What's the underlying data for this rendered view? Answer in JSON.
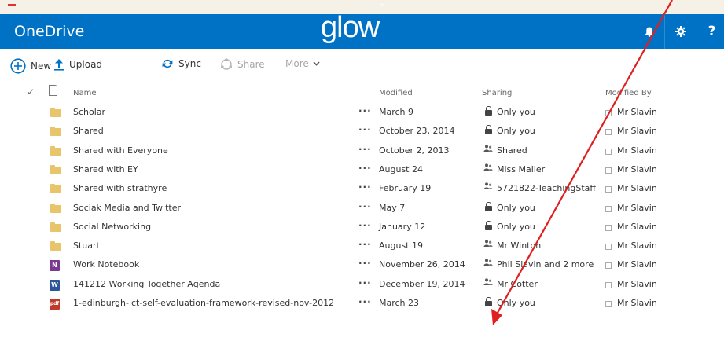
{
  "header": {
    "app_name": "OneDrive",
    "logo_text": "glow",
    "logo_mark": "™",
    "bell_icon": "bell-icon",
    "gear_icon": "gear-icon",
    "help_label": "?"
  },
  "toolbar": {
    "new_label": "New",
    "upload_label": "Upload",
    "sync_label": "Sync",
    "share_label": "Share",
    "more_label": "More"
  },
  "columns": {
    "name": "Name",
    "modified": "Modified",
    "sharing": "Sharing",
    "modified_by": "Modified By"
  },
  "files": [
    {
      "type": "folder",
      "name": "Scholar",
      "modified": "March 9",
      "sharing": "Only you",
      "sharing_icon": "lock-icon",
      "modified_by": "Mr Slavin"
    },
    {
      "type": "folder",
      "name": "Shared",
      "modified": "October 23, 2014",
      "sharing": "Only you",
      "sharing_icon": "lock-icon",
      "modified_by": "Mr Slavin"
    },
    {
      "type": "folder",
      "name": "Shared with Everyone",
      "modified": "October 2, 2013",
      "sharing": "Shared",
      "sharing_icon": "people-icon",
      "modified_by": "Mr Slavin"
    },
    {
      "type": "folder",
      "name": "Shared with EY",
      "modified": "August 24",
      "sharing": "Miss Mailer",
      "sharing_icon": "people-icon",
      "modified_by": "Mr Slavin"
    },
    {
      "type": "folder",
      "name": "Shared with strathyre",
      "modified": "February 19",
      "sharing": "5721822-TeachingStaff",
      "sharing_icon": "people-icon",
      "modified_by": "Mr Slavin"
    },
    {
      "type": "folder",
      "name": "Sociak Media and Twitter",
      "modified": "May 7",
      "sharing": "Only you",
      "sharing_icon": "lock-icon",
      "modified_by": "Mr Slavin"
    },
    {
      "type": "folder",
      "name": "Social Networking",
      "modified": "January 12",
      "sharing": "Only you",
      "sharing_icon": "lock-icon",
      "modified_by": "Mr Slavin"
    },
    {
      "type": "folder",
      "name": "Stuart",
      "modified": "August 19",
      "sharing": "Mr Winton",
      "sharing_icon": "people-icon",
      "modified_by": "Mr Slavin"
    },
    {
      "type": "onenote",
      "name": "Work Notebook",
      "modified": "November 26, 2014",
      "sharing": "Phil Slavin and 2 more",
      "sharing_icon": "people-icon",
      "modified_by": "Mr Slavin"
    },
    {
      "type": "word",
      "name": "141212 Working Together Agenda",
      "modified": "December 19, 2014",
      "sharing": "Mr Cotter",
      "sharing_icon": "people-icon",
      "modified_by": "Mr Slavin"
    },
    {
      "type": "pdf",
      "name": "1-edinburgh-ict-self-evaluation-framework-revised-nov-2012",
      "modified": "March 23",
      "sharing": "Only you",
      "sharing_icon": "lock-icon",
      "modified_by": "Mr Slavin"
    }
  ],
  "colors": {
    "header_bg": "#0072c6",
    "folder": "#e8c56b",
    "annotation_arrow": "#e02020",
    "onenote": "#7a3b8e",
    "word": "#2b579a",
    "pdf": "#c0392b"
  }
}
